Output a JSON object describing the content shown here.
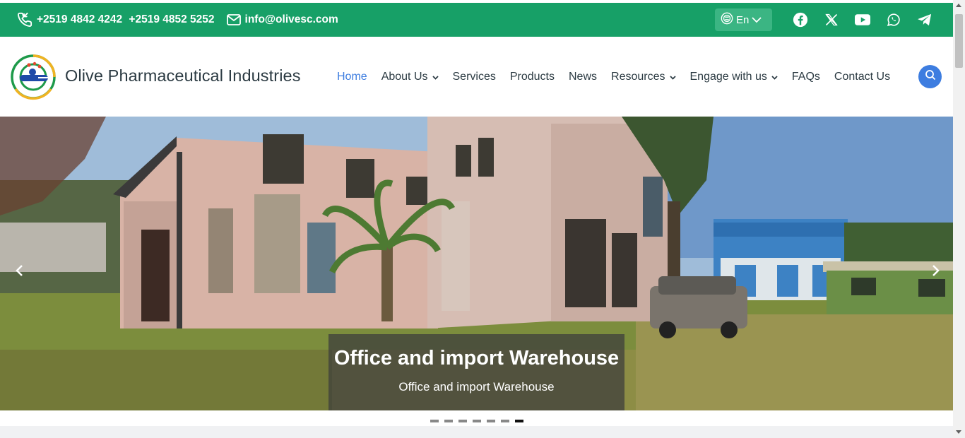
{
  "topbar": {
    "phones": [
      "+2519 4842 4242",
      "+2519 4852 5252"
    ],
    "email": "info@olivesc.com",
    "language": "En",
    "socials": [
      "facebook-icon",
      "x-twitter-icon",
      "youtube-icon",
      "whatsapp-icon",
      "telegram-icon"
    ]
  },
  "header": {
    "brand": "Olive Pharmaceutical Industries",
    "nav": [
      {
        "label": "Home",
        "active": true,
        "dropdown": false
      },
      {
        "label": "About Us",
        "dropdown": true
      },
      {
        "label": "Services",
        "dropdown": false
      },
      {
        "label": "Products",
        "dropdown": false
      },
      {
        "label": "News",
        "dropdown": false
      },
      {
        "label": "Resources",
        "dropdown": true
      },
      {
        "label": "Engage with us",
        "dropdown": true
      },
      {
        "label": "FAQs",
        "dropdown": false
      },
      {
        "label": "Contact Us",
        "dropdown": false
      }
    ]
  },
  "hero": {
    "title": "Office and import Warehouse",
    "subtitle": "Office and import Warehouse",
    "slide_count": 7,
    "active_slide": 7
  },
  "colors": {
    "topbar": "#17a067",
    "accent": "#3d7de0",
    "text": "#2b3a42"
  }
}
